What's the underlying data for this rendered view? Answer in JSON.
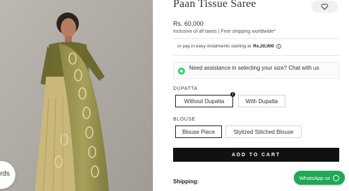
{
  "product": {
    "title": "Paan Tissue Saree",
    "price": "Rs. 60,000",
    "tax_note": "Inclusive of all taxes | Free shipping worldwide*",
    "emi_prefix": "or pay in easy instalments starting at",
    "emi_amount": "Rs.20,000",
    "assist_text": "Need assistance in selecting your size? Chat with us"
  },
  "carousel": {
    "peek_text": "rds"
  },
  "dupatta": {
    "label": "DUPATTA",
    "options": [
      "Without Dupatta",
      "With Dupatta"
    ],
    "selected": "Without Dupatta"
  },
  "blouse": {
    "label": "BLOUSE",
    "options": [
      "Blouse Piece",
      "Stylized Stitched Blouse"
    ],
    "selected": "Blouse Piece"
  },
  "actions": {
    "add_to_cart": "ADD TO CART"
  },
  "shipping": {
    "label": "Shipping:"
  },
  "whatsapp": {
    "label": "WhatsApp us"
  },
  "icons": {
    "wishlist": "heart-icon",
    "emi_info": "info-icon",
    "whatsapp": "whatsapp-icon"
  },
  "colors": {
    "cart_button": "#111111",
    "whatsapp": "#1fa855",
    "image_bg": "#b2ada8"
  }
}
